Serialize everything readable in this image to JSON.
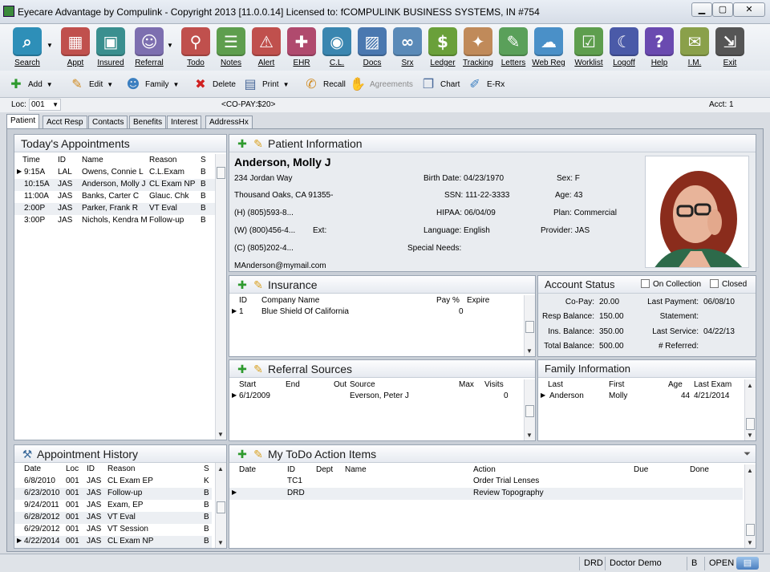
{
  "window": {
    "title": "Eyecare Advantage by Compulink - Copyright 2013 [11.0.0.14] Licensed to: fCOMPULINK BUSINESS SYSTEMS, IN #754"
  },
  "toolbar": [
    {
      "label": "Search",
      "icon": "search-icon",
      "color": "#2e8fb8",
      "glyph": "⌕"
    },
    {
      "label": "Appt",
      "icon": "calendar-icon",
      "color": "#c0504d",
      "glyph": "▦"
    },
    {
      "label": "Insured",
      "icon": "id-card-icon",
      "color": "#3a8f8f",
      "glyph": "▣"
    },
    {
      "label": "Referral",
      "icon": "people-icon",
      "color": "#7d6fb0",
      "glyph": "☺"
    },
    {
      "label": "Todo",
      "icon": "pin-icon",
      "color": "#c0504d",
      "glyph": "⚲"
    },
    {
      "label": "Notes",
      "icon": "notes-icon",
      "color": "#5e9e4e",
      "glyph": "☰"
    },
    {
      "label": "Alert",
      "icon": "alert-icon",
      "color": "#c0504d",
      "glyph": "⚠"
    },
    {
      "label": "EHR",
      "icon": "medical-bag-icon",
      "color": "#b04a6e",
      "glyph": "✚"
    },
    {
      "label": "C.L.",
      "icon": "eye-icon",
      "color": "#3a86b0",
      "glyph": "◉"
    },
    {
      "label": "Docs",
      "icon": "image-icon",
      "color": "#4a78b0",
      "glyph": "▨"
    },
    {
      "label": "Srx",
      "icon": "glasses-icon",
      "color": "#5a8ab8",
      "glyph": "∞"
    },
    {
      "label": "Ledger",
      "icon": "dollar-icon",
      "color": "#6aa03a",
      "glyph": "$"
    },
    {
      "label": "Tracking",
      "icon": "footprints-icon",
      "color": "#c08a5a",
      "glyph": "✦"
    },
    {
      "label": "Letters",
      "icon": "paperclip-icon",
      "color": "#5aa05a",
      "glyph": "✎"
    },
    {
      "label": "Web Reg",
      "icon": "cloud-upload-icon",
      "color": "#4a90c8",
      "glyph": "☁"
    },
    {
      "label": "Worklist",
      "icon": "clipboard-icon",
      "color": "#5e9e4e",
      "glyph": "☑"
    },
    {
      "label": "Logoff",
      "icon": "moon-icon",
      "color": "#4a5aa8",
      "glyph": "☾"
    },
    {
      "label": "Help",
      "icon": "help-icon",
      "color": "#6a4ab0",
      "glyph": "?"
    },
    {
      "label": "I.M.",
      "icon": "chat-icon",
      "color": "#8aa04a",
      "glyph": "✉"
    },
    {
      "label": "Exit",
      "icon": "exit-icon",
      "color": "#555555",
      "glyph": "⇲"
    }
  ],
  "toolbar2": [
    {
      "label": "Add",
      "icon": "add-icon"
    },
    {
      "label": "Edit",
      "icon": "pencil-icon"
    },
    {
      "label": "Family",
      "icon": "family-icon"
    },
    {
      "label": "Delete",
      "icon": "delete-icon"
    },
    {
      "label": "Print",
      "icon": "printer-icon"
    },
    {
      "label": "Recall",
      "icon": "phone-icon"
    },
    {
      "label": "Agreements",
      "icon": "handshake-icon"
    },
    {
      "label": "Chart",
      "icon": "chart-doc-icon"
    },
    {
      "label": "E-Rx",
      "icon": "erx-icon"
    }
  ],
  "locbar": {
    "loc_label": "Loc:",
    "loc_value": "001",
    "copay": "<CO-PAY:$20>",
    "acct": "Acct:  1"
  },
  "tabs": [
    "Patient",
    "Acct Resp",
    "Contacts",
    "Benefits",
    "Interest",
    "AddressHx"
  ],
  "appointments": {
    "title": "Today's Appointments",
    "columns": [
      "Time",
      "ID",
      "Name",
      "Reason",
      "S"
    ],
    "rows": [
      [
        "9:15A",
        "LAL",
        "Owens, Connie L",
        "C.L.Exam",
        "B"
      ],
      [
        "10:15A",
        "JAS",
        "Anderson, Molly J",
        "CL Exam NP",
        "B"
      ],
      [
        "11:00A",
        "JAS",
        "Banks, Carter C",
        "Glauc. Chk",
        "B"
      ],
      [
        "2:00P",
        "JAS",
        "Parker, Frank R",
        "VT Eval",
        "B"
      ],
      [
        "3:00P",
        "JAS",
        "Nichols, Kendra M",
        "Follow-up",
        "B"
      ]
    ]
  },
  "patient": {
    "title": "Patient Information",
    "name": "Anderson, Molly J",
    "address1": "234 Jordan Way",
    "address2": "Thousand Oaks, CA  91355-",
    "home": "(H)  (805)593-8...",
    "work": "(W)  (800)456-4...",
    "ext_label": "Ext:",
    "cell": "(C)  (805)202-4...",
    "email": "MAnderson@mymail.com",
    "birth_date": "Birth Date:  04/23/1970",
    "ssn": "SSN:  111-22-3333",
    "hipaa": "HIPAA:  06/04/09",
    "language": "Language:  English",
    "special_needs": "Special Needs:",
    "sex": "Sex:  F",
    "age": "Age:  43",
    "plan": "Plan:  Commercial",
    "provider": "Provider:  JAS"
  },
  "insurance": {
    "title": "Insurance",
    "columns": [
      "ID",
      "Company Name",
      "Pay %",
      "Expire"
    ],
    "rows": [
      [
        "1",
        "Blue Shield Of California",
        "0",
        ""
      ]
    ]
  },
  "account": {
    "title": "Account Status",
    "on_collection": "On Collection",
    "closed": "Closed",
    "copay": "Co-Pay:",
    "copay_v": "20.00",
    "resp": "Resp Balance:",
    "resp_v": "150.00",
    "ins": "Ins. Balance:",
    "ins_v": "350.00",
    "total": "Total Balance:",
    "total_v": "500.00",
    "last_payment": "Last Payment:",
    "last_payment_v": "06/08/10",
    "statement": "Statement:",
    "last_service": "Last Service:",
    "last_service_v": "04/22/13",
    "referred": "# Referred:"
  },
  "referral": {
    "title": "Referral Sources",
    "columns": [
      "Start",
      "End",
      "Out",
      "Source",
      "Max",
      "Visits"
    ],
    "rows": [
      [
        "6/1/2009",
        "",
        "",
        "Everson, Peter J",
        "",
        "0"
      ]
    ]
  },
  "family": {
    "title": "Family Information",
    "columns": [
      "Last",
      "First",
      "Age",
      "Last Exam"
    ],
    "rows": [
      [
        "Anderson",
        "Molly",
        "44",
        "4/21/2014"
      ]
    ]
  },
  "history": {
    "title": "Appointment History",
    "columns": [
      "Date",
      "Loc",
      "ID",
      "Reason",
      "S"
    ],
    "rows": [
      [
        "6/8/2010",
        "001",
        "JAS",
        "CL Exam EP",
        "K"
      ],
      [
        "6/23/2010",
        "001",
        "JAS",
        "Follow-up",
        "B"
      ],
      [
        "9/24/2011",
        "001",
        "JAS",
        "Exam, EP",
        "B"
      ],
      [
        "6/28/2012",
        "001",
        "JAS",
        "VT Eval",
        "B"
      ],
      [
        "6/29/2012",
        "001",
        "JAS",
        "VT Session",
        "B"
      ],
      [
        "4/22/2014",
        "001",
        "JAS",
        "CL Exam NP",
        "B"
      ]
    ]
  },
  "todo": {
    "title": "My ToDo Action Items",
    "columns": [
      "Date",
      "ID",
      "Dept",
      "Name",
      "Action",
      "Due",
      "Done"
    ],
    "rows": [
      [
        "",
        "TC1",
        "",
        "",
        "Order Trial Lenses",
        "",
        ""
      ],
      [
        "",
        "DRD",
        "",
        "",
        "Review Topography",
        "",
        ""
      ]
    ]
  },
  "status": {
    "user": "DRD",
    "doctor": "Doctor Demo",
    "code": "B",
    "state": "OPEN"
  }
}
